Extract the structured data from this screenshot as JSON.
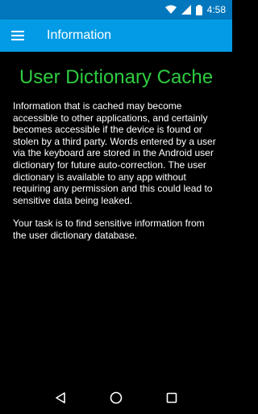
{
  "status_bar": {
    "time": "4:58",
    "icons": [
      "wifi-icon",
      "cell-signal-icon",
      "battery-icon"
    ]
  },
  "app_bar": {
    "menu_icon": "hamburger-menu-icon",
    "title": "Information"
  },
  "content": {
    "heading": "User Dictionary Cache",
    "paragraph_1": "Information that is cached may become accessible to other applications, and certainly becomes accessible if the device is found or stolen by a third party. Words entered by a user via the keyboard are stored in the Android user dictionary for future auto-correction. The user dictionary is available to any app without requiring any permission and this could lead to sensitive data being leaked.",
    "paragraph_2": "Your task is to find sensitive information from the user dictionary database."
  },
  "nav_bar": {
    "buttons": [
      "back-icon",
      "home-icon",
      "recents-icon"
    ]
  },
  "colors": {
    "status_bar": "#0277bd",
    "app_bar": "#039be5",
    "heading": "#2ecc40",
    "background": "#000000"
  }
}
